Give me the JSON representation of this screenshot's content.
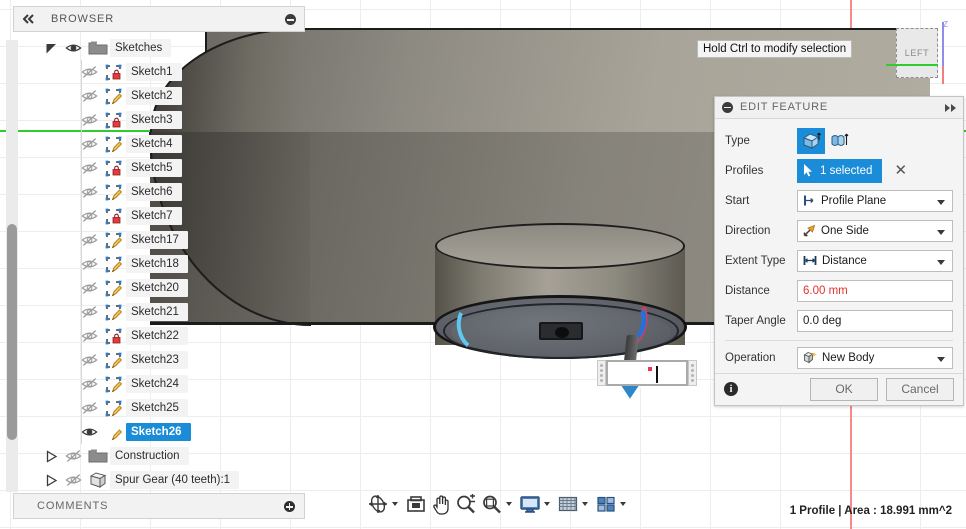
{
  "browser": {
    "title": "BROWSER",
    "collapse_icon": "minus-circle-icon",
    "tree": [
      {
        "label": "Sketches",
        "icon": "folder-icon",
        "visible": true,
        "expanded": true,
        "selected": false,
        "depth": 0,
        "has_arrow": true
      },
      {
        "label": "Sketch1",
        "icon": "sketch-locked-icon",
        "visible": false,
        "selected": false,
        "depth": 1
      },
      {
        "label": "Sketch2",
        "icon": "sketch-edit-icon",
        "visible": false,
        "selected": false,
        "depth": 1
      },
      {
        "label": "Sketch3",
        "icon": "sketch-locked-icon",
        "visible": false,
        "selected": false,
        "depth": 1
      },
      {
        "label": "Sketch4",
        "icon": "sketch-edit-icon",
        "visible": false,
        "selected": false,
        "depth": 1
      },
      {
        "label": "Sketch5",
        "icon": "sketch-locked-icon",
        "visible": false,
        "selected": false,
        "depth": 1
      },
      {
        "label": "Sketch6",
        "icon": "sketch-edit-icon",
        "visible": false,
        "selected": false,
        "depth": 1
      },
      {
        "label": "Sketch7",
        "icon": "sketch-locked-icon",
        "visible": false,
        "selected": false,
        "depth": 1
      },
      {
        "label": "Sketch17",
        "icon": "sketch-edit-icon",
        "visible": false,
        "selected": false,
        "depth": 1
      },
      {
        "label": "Sketch18",
        "icon": "sketch-edit-icon",
        "visible": false,
        "selected": false,
        "depth": 1
      },
      {
        "label": "Sketch20",
        "icon": "sketch-edit-icon",
        "visible": false,
        "selected": false,
        "depth": 1
      },
      {
        "label": "Sketch21",
        "icon": "sketch-edit-icon",
        "visible": false,
        "selected": false,
        "depth": 1
      },
      {
        "label": "Sketch22",
        "icon": "sketch-locked-icon",
        "visible": false,
        "selected": false,
        "depth": 1
      },
      {
        "label": "Sketch23",
        "icon": "sketch-edit-icon",
        "visible": false,
        "selected": false,
        "depth": 1
      },
      {
        "label": "Sketch24",
        "icon": "sketch-edit-icon",
        "visible": false,
        "selected": false,
        "depth": 1
      },
      {
        "label": "Sketch25",
        "icon": "sketch-edit-icon",
        "visible": false,
        "selected": false,
        "depth": 1
      },
      {
        "label": "Sketch26",
        "icon": "sketch-edit-icon",
        "visible": true,
        "selected": true,
        "depth": 1
      },
      {
        "label": "Construction",
        "icon": "folder-icon",
        "visible": false,
        "expanded": false,
        "selected": false,
        "depth": 0,
        "has_arrow": true
      },
      {
        "label": "Spur Gear (40 teeth):1",
        "icon": "body-icon",
        "visible": false,
        "expanded": false,
        "selected": false,
        "depth": 0,
        "has_arrow": true
      }
    ]
  },
  "comments": {
    "title": "COMMENTS",
    "add_icon": "plus-circle-icon"
  },
  "tooltip": {
    "text": "Hold Ctrl to modify selection"
  },
  "dialog": {
    "title": "EDIT FEATURE",
    "collapse_icon": "minus-circle-icon",
    "expand_icon": "double-chevron-right-icon",
    "rows": {
      "type": {
        "label": "Type",
        "options": [
          {
            "name": "extrude-profile-icon",
            "selected": true
          },
          {
            "name": "extrude-surface-icon",
            "selected": false
          }
        ]
      },
      "profiles": {
        "label": "Profiles",
        "value": "1 selected",
        "select_icon": "cursor-arrow-icon",
        "clear_icon": "x-icon"
      },
      "start": {
        "label": "Start",
        "value": "Profile Plane",
        "icon": "start-plane-icon"
      },
      "direction": {
        "label": "Direction",
        "value": "One Side",
        "icon": "one-side-arrow-icon"
      },
      "extent_type": {
        "label": "Extent Type",
        "value": "Distance",
        "icon": "distance-icon"
      },
      "distance": {
        "label": "Distance",
        "value": "6.00 mm"
      },
      "taper_angle": {
        "label": "Taper Angle",
        "value": "0.0 deg"
      },
      "operation": {
        "label": "Operation",
        "value": "New Body",
        "icon": "new-body-icon"
      }
    },
    "footer": {
      "info_icon": "info-icon",
      "ok_label": "OK",
      "cancel_label": "Cancel"
    },
    "accent_color": "#1a8cd8",
    "value_color": "#e0312f"
  },
  "canvas": {
    "dimension_input": {
      "value": "",
      "placeholder": ""
    },
    "viewcube": {
      "face_label": "LEFT",
      "z_label": "Z"
    },
    "axis_color_horizontal": "#2ecc2e",
    "axis_color_vertical": "#f98a8a"
  },
  "navbar": {
    "items": [
      {
        "name": "orbit-icon",
        "has_caret": true
      },
      {
        "name": "look-at-icon",
        "has_caret": false
      },
      {
        "name": "pan-hand-icon",
        "has_caret": false
      },
      {
        "name": "zoom-inout-icon",
        "has_caret": false
      },
      {
        "name": "zoom-fit-icon",
        "has_caret": true
      },
      {
        "name": "display-settings-icon",
        "has_caret": true
      },
      {
        "name": "grid-snaps-icon",
        "has_caret": true
      },
      {
        "name": "viewports-icon",
        "has_caret": true
      }
    ]
  },
  "status": {
    "text": "1 Profile | Area : 18.991 mm^2"
  }
}
